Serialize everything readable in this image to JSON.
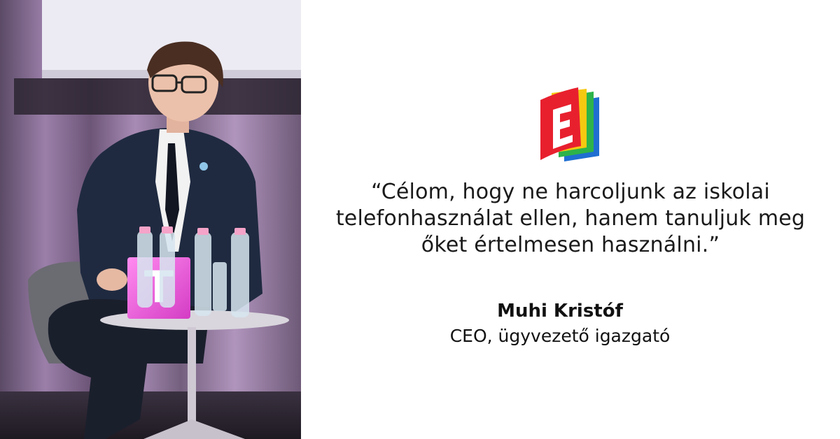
{
  "photo": {
    "alt_subject": "speaker-seated-on-stage"
  },
  "logo": {
    "letter": "E",
    "colors": [
      "#e8202e",
      "#f6c911",
      "#2db34a",
      "#1f6fd1"
    ]
  },
  "quote": {
    "line1": "“Célom, hogy ne harcoljunk az iskolai",
    "line2": "telefonhasználat ellen, hanem tanuljuk meg",
    "line3": "őket értelmesen használni.”"
  },
  "speaker": {
    "name": "Muhi Kristóf",
    "role": "CEO, ügyvezető igazgató"
  },
  "colors": {
    "background": "#ffffff",
    "text": "#1a1a1a",
    "stage_purple": "#8a6a9a",
    "magenta": "#e23bd1"
  }
}
